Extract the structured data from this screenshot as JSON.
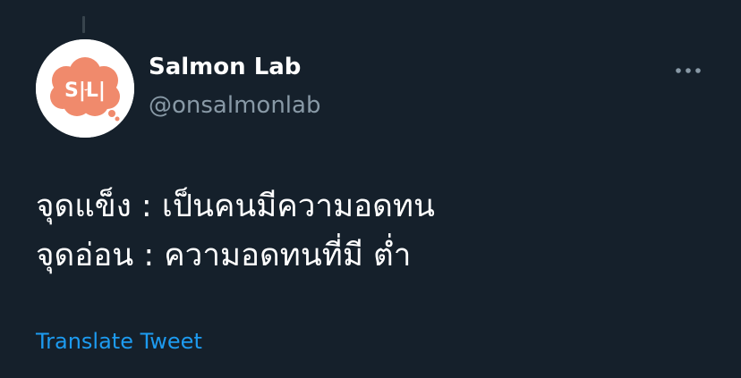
{
  "tweet": {
    "author": {
      "display_name": "Salmon Lab",
      "handle": "@onsalmonlab",
      "avatar": {
        "logo_text": "S|L|",
        "background_color": "#ffffff",
        "logo_color": "#f08a6c"
      }
    },
    "menu_icon": "more-horizontal-icon",
    "text_lines": [
      "จุดแข็ง : เป็นคนมีความอดทน",
      "จุดอ่อน : ความอดทนที่มี ต่ำ"
    ],
    "translate_label": "Translate Tweet"
  },
  "colors": {
    "background": "#15202b",
    "primary_text": "#ffffff",
    "secondary_text": "#8899a6",
    "link": "#1d9bf0"
  }
}
